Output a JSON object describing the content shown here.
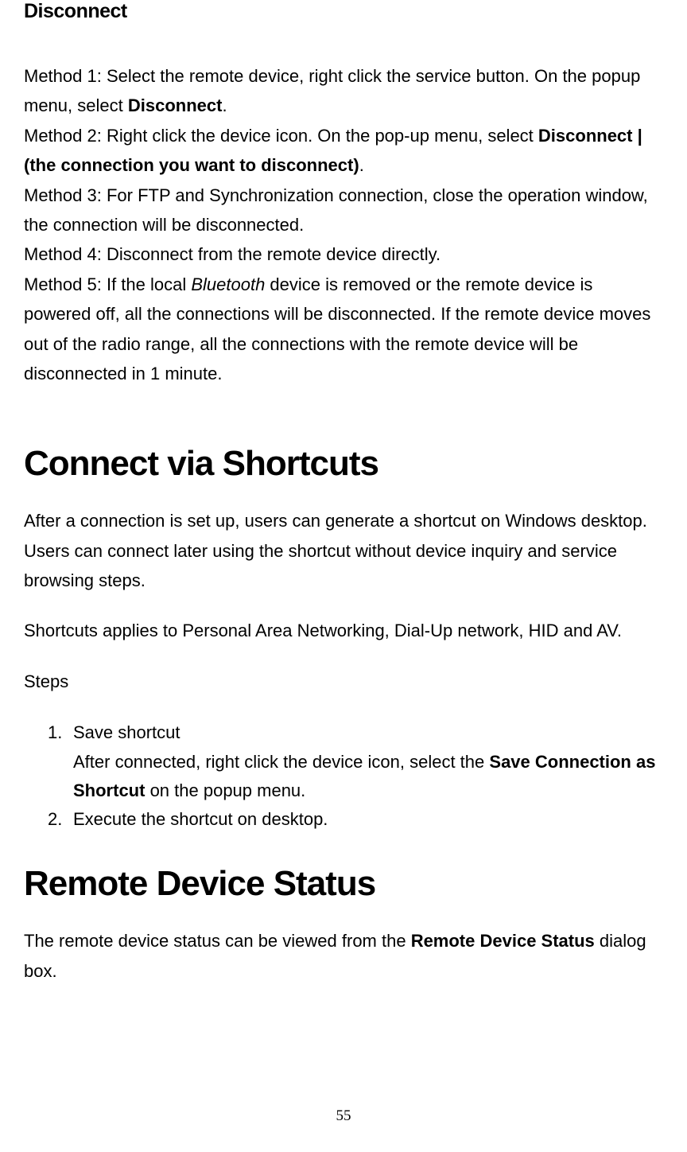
{
  "sections": {
    "disconnect": {
      "title": "Disconnect",
      "method1_pre": "Method 1: Select the remote device, right click the service button. On the popup menu, select ",
      "method1_bold": "Disconnect",
      "method1_post": ".",
      "method2_pre": "Method 2: Right click the device icon. On the pop-up menu, select ",
      "method2_bold1": "Disconnect | (the connection you want to disconnect)",
      "method2_post": ".",
      "method3": "Method 3: For FTP and Synchronization connection, close the operation window, the connection will be disconnected.",
      "method4": "Method 4: Disconnect from the remote device directly.",
      "method5_pre": "Method 5: If the local ",
      "method5_italic": "Bluetooth",
      "method5_post": " device is removed or the remote device is powered off, all the connections will be disconnected. If the remote device moves out of the radio range, all the connections with   the remote device will be disconnected in 1 minute."
    },
    "shortcuts": {
      "title": "Connect via Shortcuts",
      "intro": "After a connection is set up, users can generate a shortcut on Windows desktop. Users can connect later using the shortcut without device inquiry and service browsing steps.",
      "applies": "Shortcuts applies to Personal Area Networking, Dial-Up network, HID and AV.",
      "steps_label": "Steps",
      "step1_title": "Save shortcut",
      "step1_pre": "After connected, right click the device icon, select the ",
      "step1_bold": "Save Connection as Shortcut",
      "step1_post": " on the popup menu.",
      "step2": "Execute the shortcut on desktop."
    },
    "status": {
      "title": "Remote Device Status",
      "text_pre": "The remote device status can be viewed from the ",
      "text_bold": "Remote Device Status",
      "text_post": " dialog box."
    }
  },
  "list_numbers": {
    "one": "1.",
    "two": "2."
  },
  "page_number": "55"
}
